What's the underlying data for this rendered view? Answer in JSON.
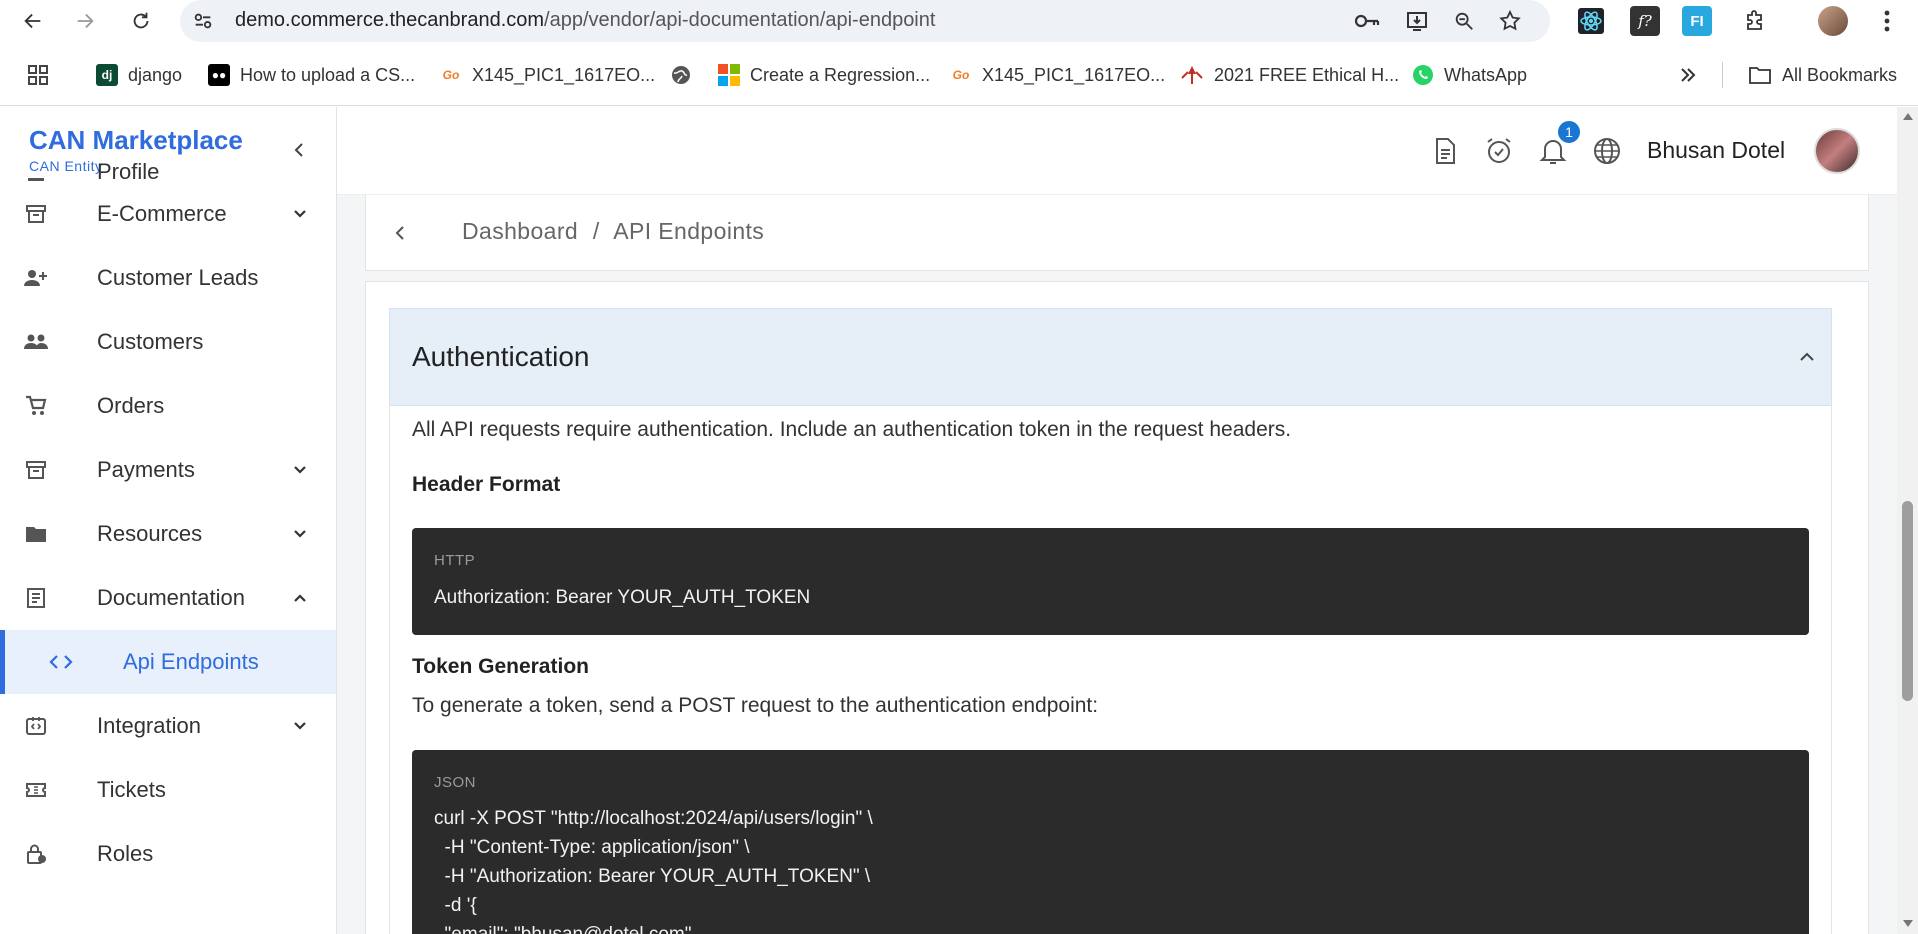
{
  "browser": {
    "url_host": "demo.commerce.thecanbrand.com",
    "url_path": "/app/vendor/api-documentation/api-endpoint",
    "bookmarks": [
      "django",
      "How to upload a CS...",
      "X145_PIC1_1617EO...",
      "",
      "Create a Regression...",
      "X145_PIC1_1617EO...",
      "2021 FREE Ethical H...",
      "WhatsApp"
    ],
    "all_bookmarks": "All Bookmarks",
    "ext_f": "f?",
    "ext_fi": "FI"
  },
  "brand": {
    "title": "CAN Marketplace",
    "subtitle": "CAN Entity"
  },
  "sidebar": {
    "items": [
      {
        "label": "Profile"
      },
      {
        "label": "E-Commerce"
      },
      {
        "label": "Customer Leads"
      },
      {
        "label": "Customers"
      },
      {
        "label": "Orders"
      },
      {
        "label": "Payments"
      },
      {
        "label": "Resources"
      },
      {
        "label": "Documentation"
      },
      {
        "label": "Api Endpoints"
      },
      {
        "label": "Integration"
      },
      {
        "label": "Tickets"
      },
      {
        "label": "Roles"
      }
    ]
  },
  "header": {
    "notification_count": "1",
    "user_name": "Bhusan Dotel"
  },
  "breadcrumb": {
    "home": "Dashboard",
    "separator": "/",
    "current": "API Endpoints"
  },
  "section": {
    "title": "Authentication",
    "intro": "All API requests require authentication. Include an authentication token in the request headers.",
    "header_format_title": "Header Format",
    "code1_lang": "HTTP",
    "code1_line": "Authorization: Bearer YOUR_AUTH_TOKEN",
    "token_title": "Token Generation",
    "token_text": "To generate a token, send a POST request to the authentication endpoint:",
    "code2_lang": "JSON",
    "code2_lines": [
      "curl -X POST \"http://localhost:2024/api/users/login\" \\",
      "  -H \"Content-Type: application/json\" \\",
      "  -H \"Authorization: Bearer YOUR_AUTH_TOKEN\" \\",
      "  -d '{",
      "  \"email\": \"bhusan@dotel.com\","
    ]
  },
  "colors": {
    "accent": "#2f6ce0",
    "active_bg": "#e7f0fb",
    "code_bg": "#2b2b2b",
    "accordion_bg": "#e6eef8",
    "badge": "#1976d2"
  }
}
